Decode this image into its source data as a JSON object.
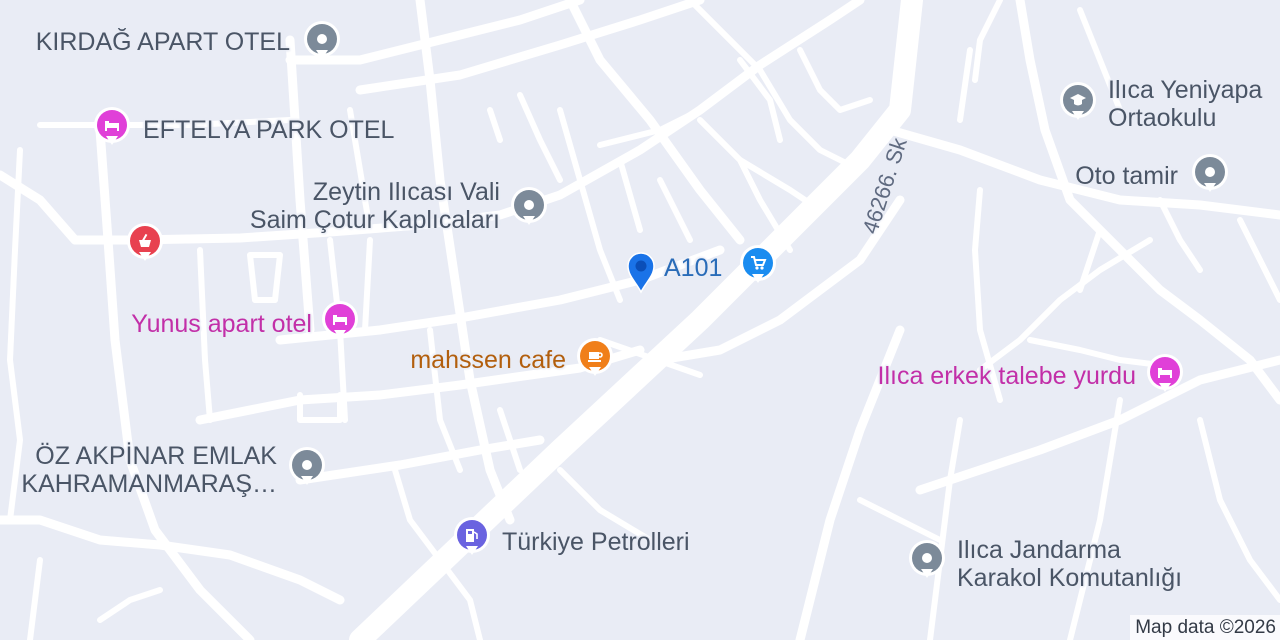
{
  "map": {
    "street_label": "46266. Sk",
    "attribution": "Map data ©2026",
    "pois": [
      {
        "id": "kirdag-apart-otel",
        "lines": [
          "KIRDAĞ APART OTEL"
        ],
        "icon": "generic-pin-icon",
        "color": "#7c8a99",
        "text_color": "#4a5566"
      },
      {
        "id": "eftelya-park-otel",
        "lines": [
          "EFTELYA PARK OTEL"
        ],
        "icon": "bed-icon",
        "color": "#e040d8",
        "text_color": "#4a5566"
      },
      {
        "id": "zeytin-ilicasi",
        "lines": [
          "Zeytin Ilıcası Vali",
          "Saim Çotur Kaplıcaları"
        ],
        "icon": "generic-pin-icon",
        "color": "#7c8a99",
        "text_color": "#4a5566"
      },
      {
        "id": "pharmacy",
        "lines": [],
        "icon": "mortar-pestle-icon",
        "color": "#e8414f",
        "text_color": "#4a5566"
      },
      {
        "id": "a101",
        "lines": [
          "A101"
        ],
        "icon": "shopping-cart-icon",
        "color": "#1a8cf0",
        "text_color": "#2a6cb8"
      },
      {
        "id": "yunus-apart-otel",
        "lines": [
          "Yunus apart otel"
        ],
        "icon": "bed-icon",
        "color": "#e040d8",
        "text_color": "#c22fa8"
      },
      {
        "id": "mahssen-cafe",
        "lines": [
          "mahssen cafe"
        ],
        "icon": "coffee-cup-icon",
        "color": "#f07f1a",
        "text_color": "#b25f0e"
      },
      {
        "id": "oz-akpinar-emlak",
        "lines": [
          "ÖZ AKPİNAR EMLAK",
          "KAHRAMANMARAŞ…"
        ],
        "icon": "generic-pin-icon",
        "color": "#7c8a99",
        "text_color": "#4a5566"
      },
      {
        "id": "turkiye-petrolleri",
        "lines": [
          "Türkiye Petrolleri"
        ],
        "icon": "fuel-pump-icon",
        "color": "#6a63e0",
        "text_color": "#4a5566"
      },
      {
        "id": "ilica-yeniyapan-ortaokulu",
        "lines": [
          "Ilıca Yeniyapa",
          "Ortaokulu"
        ],
        "icon": "graduation-cap-icon",
        "color": "#7c8a99",
        "text_color": "#4a5566"
      },
      {
        "id": "oto-tamir",
        "lines": [
          "Oto tamir"
        ],
        "icon": "generic-pin-icon",
        "color": "#7c8a99",
        "text_color": "#4a5566"
      },
      {
        "id": "ilica-erkek-talebe-yurdu",
        "lines": [
          "Ilıca erkek talebe yurdu"
        ],
        "icon": "bed-icon",
        "color": "#e040d8",
        "text_color": "#c22fa8"
      },
      {
        "id": "ilica-jandarma",
        "lines": [
          "Ilıca Jandarma",
          "Karakol Komutanlığı"
        ],
        "icon": "generic-pin-icon",
        "color": "#7c8a99",
        "text_color": "#4a5566"
      }
    ],
    "marker": {
      "icon": "location-marker-icon",
      "color": "#1a73e8"
    }
  }
}
